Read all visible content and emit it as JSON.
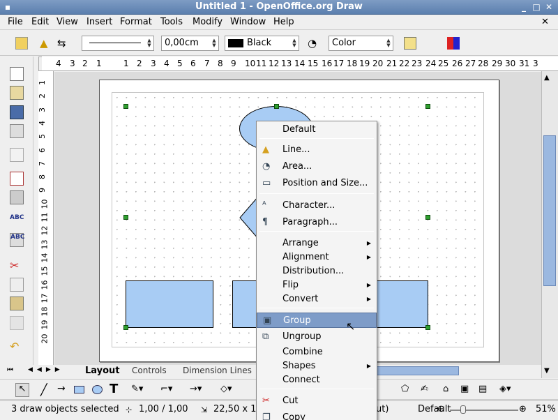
{
  "window": {
    "title": "Untitled 1 - OpenOffice.org Draw"
  },
  "menubar": {
    "items": [
      "File",
      "Edit",
      "View",
      "Insert",
      "Format",
      "Tools",
      "Modify",
      "Window",
      "Help"
    ]
  },
  "toolbar": {
    "line_width": "0,00cm",
    "line_color": "Black",
    "area_style": "Color"
  },
  "hruler": {
    "ticks": [
      "4",
      "3",
      "2",
      "1",
      "1",
      "2",
      "3",
      "4",
      "5",
      "6",
      "7",
      "8",
      "9",
      "10",
      "11",
      "12",
      "13",
      "14",
      "15",
      "16",
      "17",
      "18",
      "19",
      "20",
      "21",
      "22",
      "23",
      "24",
      "25",
      "26",
      "27",
      "28",
      "29",
      "30",
      "31",
      "3"
    ]
  },
  "vruler": {
    "ticks": [
      "1",
      "2",
      "3",
      "4",
      "5",
      "6",
      "7",
      "8",
      "9",
      "10",
      "11",
      "12",
      "13",
      "14",
      "15",
      "16",
      "17",
      "18",
      "19",
      "20"
    ]
  },
  "tabs": {
    "items": [
      "Layout",
      "Controls",
      "Dimension Lines"
    ],
    "active": "Layout"
  },
  "status": {
    "selection": "3 draw objects selected",
    "position": "1,00 / 1,00",
    "size": "22,50 x 1(",
    "outline": "ut)",
    "page_style": "Default",
    "zoom": "51%"
  },
  "context_menu": {
    "items": [
      {
        "label": "Default",
        "icon": ""
      },
      {
        "label": "Line...",
        "icon": "line-icon"
      },
      {
        "label": "Area...",
        "icon": "area-icon"
      },
      {
        "label": "Position and Size...",
        "icon": "position-icon"
      },
      {
        "label": "Character...",
        "icon": "character-icon"
      },
      {
        "label": "Paragraph...",
        "icon": "paragraph-icon"
      },
      {
        "label": "Arrange",
        "icon": ""
      },
      {
        "label": "Alignment",
        "icon": ""
      },
      {
        "label": "Distribution...",
        "icon": ""
      },
      {
        "label": "Flip",
        "icon": ""
      },
      {
        "label": "Convert",
        "icon": ""
      },
      {
        "label": "Group",
        "icon": "group-icon"
      },
      {
        "label": "Ungroup",
        "icon": "ungroup-icon"
      },
      {
        "label": "Combine",
        "icon": ""
      },
      {
        "label": "Shapes",
        "icon": ""
      },
      {
        "label": "Connect",
        "icon": ""
      },
      {
        "label": "Cut",
        "icon": "cut-icon"
      },
      {
        "label": "Copy",
        "icon": "copy-icon"
      }
    ],
    "highlighted": "Group"
  },
  "colors": {
    "title_bar": "#5b7fae",
    "shape_fill": "#a8ccf4",
    "highlight": "#7e9cc8",
    "handle": "#2f9f2f"
  }
}
